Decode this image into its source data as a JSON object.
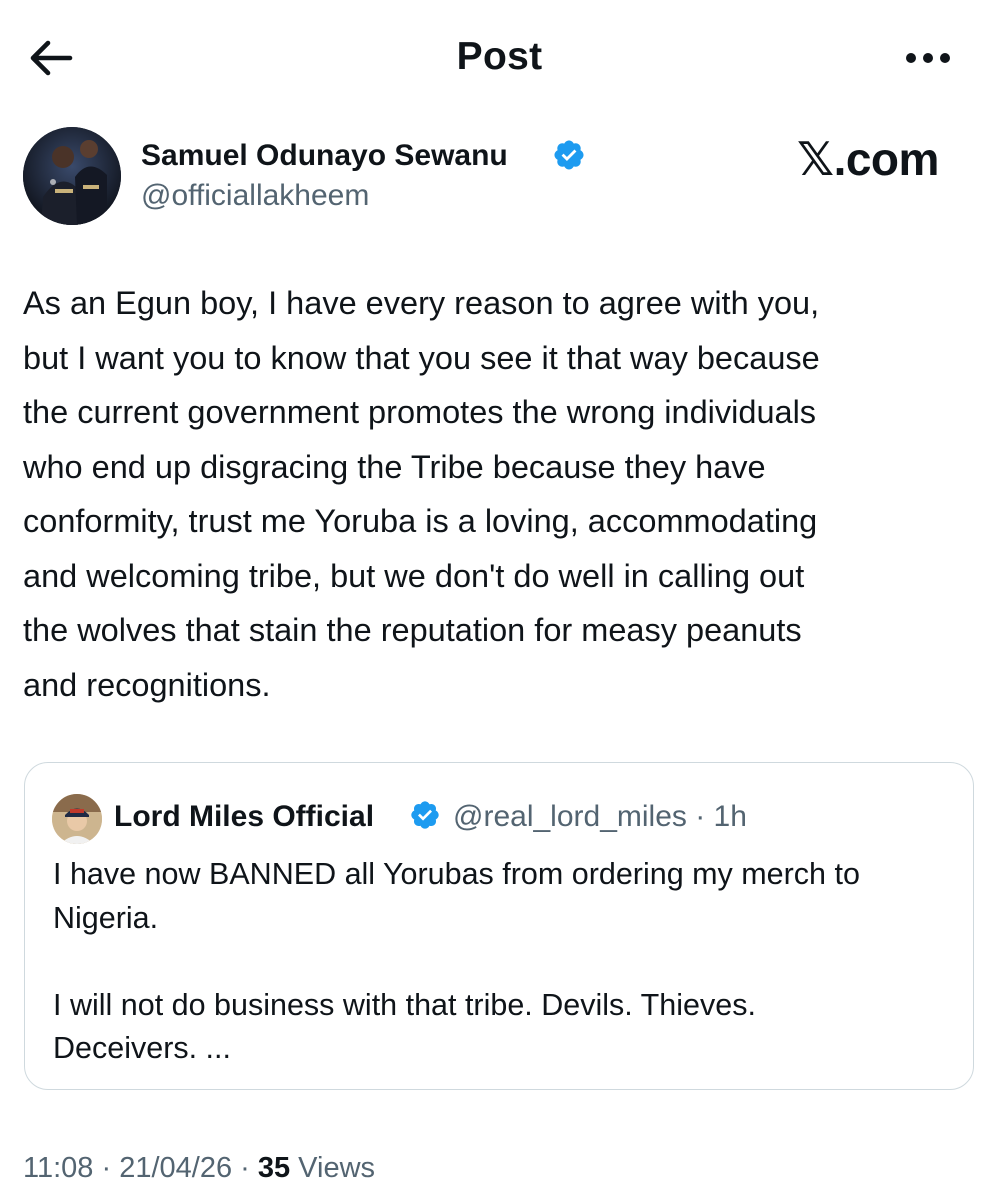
{
  "header": {
    "title": "Post",
    "back_icon": "arrow-left-icon",
    "more_icon": "more-horizontal-icon"
  },
  "watermark": {
    "glyph": "𝕏",
    "text": ".com"
  },
  "post": {
    "author": {
      "name": "Samuel Odunayo Sewanu",
      "handle": "@officiallakheem",
      "verified": true
    },
    "text_lines": [
      "As an Egun boy, I have every reason to agree with you,",
      "but I want you to know that you see it that way because",
      "the current government promotes the wrong individuals",
      "who end up disgracing the Tribe because they have",
      "conformity, trust me Yoruba is a loving, accommodating",
      "and welcoming tribe, but we don't do well in calling out",
      "the wolves that stain the reputation for measy peanuts",
      "and recognitions."
    ],
    "timestamp": "11:08 · 21/04/26 · ",
    "views_count": "35",
    "views_label": " Views"
  },
  "quote": {
    "author": {
      "name": "Lord Miles Official",
      "handle": "@real_lord_miles",
      "time": "· 1h",
      "verified": true
    },
    "text_lines": [
      "I have now BANNED all Yorubas from ordering my merch to",
      "Nigeria.",
      "",
      "I will not do business with that tribe. Devils. Thieves.",
      "Deceivers. ..."
    ]
  },
  "colors": {
    "text_primary": "#0f1419",
    "text_secondary": "#536471",
    "verified_blue": "#1d9bf0",
    "border": "#cfd9de"
  }
}
